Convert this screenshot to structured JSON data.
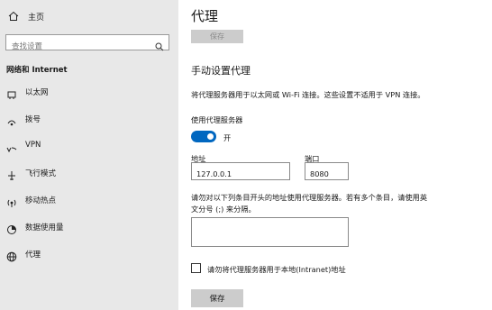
{
  "sidebar": {
    "home_label": "主页",
    "search_placeholder": "查找设置",
    "section_title": "网络和 Internet",
    "items": [
      {
        "label": "以太网",
        "icon": "ethernet-icon"
      },
      {
        "label": "拨号",
        "icon": "dialup-icon"
      },
      {
        "label": "VPN",
        "icon": "vpn-icon"
      },
      {
        "label": "飞行模式",
        "icon": "airplane-icon"
      },
      {
        "label": "移动热点",
        "icon": "hotspot-icon"
      },
      {
        "label": "数据使用量",
        "icon": "data-usage-icon"
      },
      {
        "label": "代理",
        "icon": "globe-icon"
      }
    ]
  },
  "main": {
    "title": "代理",
    "top_save_label": "保存",
    "manual_heading": "手动设置代理",
    "manual_desc": "将代理服务器用于以太网或 Wi-Fi 连接。这些设置不适用于 VPN 连接。",
    "use_proxy_label": "使用代理服务器",
    "toggle_state": "开",
    "address_label": "地址",
    "address_value": "127.0.0.1",
    "port_label": "端口",
    "port_value": "8080",
    "exceptions_line1": "请勿对以下列条目开头的地址使用代理服务器。若有多个条目，请使用英",
    "exceptions_line2": "文分号 (;) 来分隔。",
    "exceptions_value": "",
    "local_checkbox_label": "请勿将代理服务器用于本地(Intranet)地址",
    "local_checkbox_checked": false,
    "save_label": "保存"
  },
  "colors": {
    "sidebar_bg": "#e8e8e8",
    "accent": "#0067c0",
    "button_bg": "#cccccc"
  }
}
